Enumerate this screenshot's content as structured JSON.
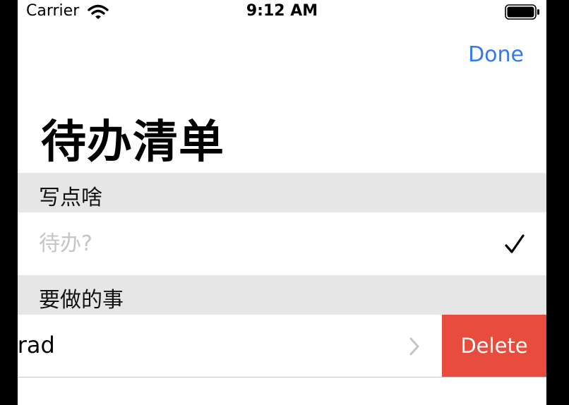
{
  "status_bar": {
    "carrier": "Carrier",
    "time": "9:12 AM",
    "battery_icon": "battery-full-icon",
    "wifi_icon": "wifi-icon"
  },
  "nav": {
    "done_label": "Done"
  },
  "title": "待办清单",
  "sections": [
    {
      "header": "写点啥",
      "input_placeholder": "待办?",
      "input_value": "",
      "action_icon": "checkmark-icon"
    },
    {
      "header": "要做的事",
      "items": [
        {
          "label": "erad",
          "accessory_icon": "chevron-right-icon",
          "swipe_action": "Delete"
        }
      ]
    }
  ],
  "colors": {
    "accent": "#3478F6",
    "delete": "#E74C3C",
    "section_header_bg": "#E6E6E6",
    "placeholder": "#C4C4C9"
  }
}
